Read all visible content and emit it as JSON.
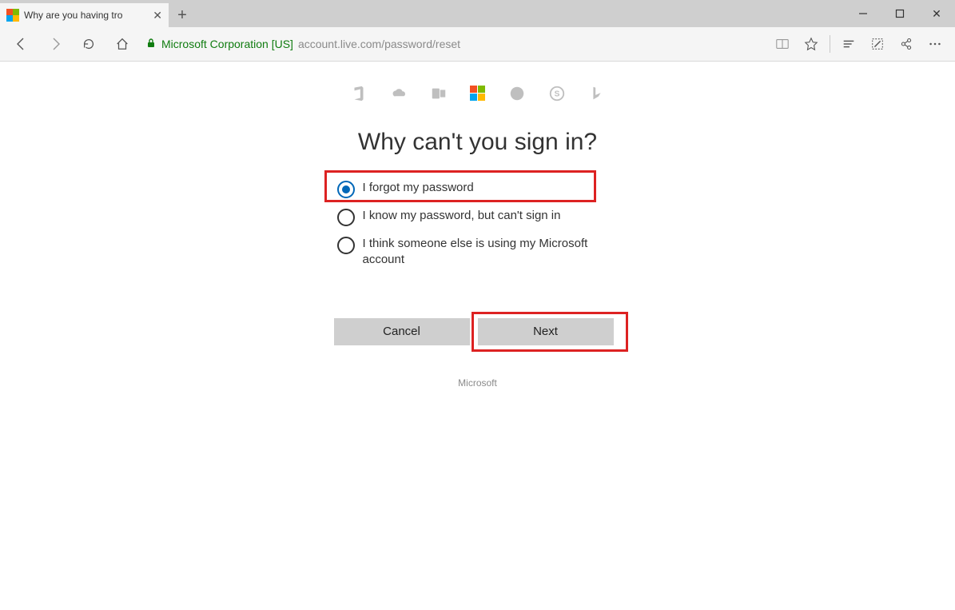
{
  "browser": {
    "tab_title": "Why are you having tro",
    "security_label": "Microsoft Corporation [US]",
    "url": "account.live.com/password/reset"
  },
  "page": {
    "heading": "Why can't you sign in?",
    "options": [
      {
        "label": "I forgot my password",
        "selected": true
      },
      {
        "label": "I know my password, but can't sign in",
        "selected": false
      },
      {
        "label": "I think someone else is using my Microsoft account",
        "selected": false
      }
    ],
    "cancel_label": "Cancel",
    "next_label": "Next",
    "footer": "Microsoft"
  }
}
